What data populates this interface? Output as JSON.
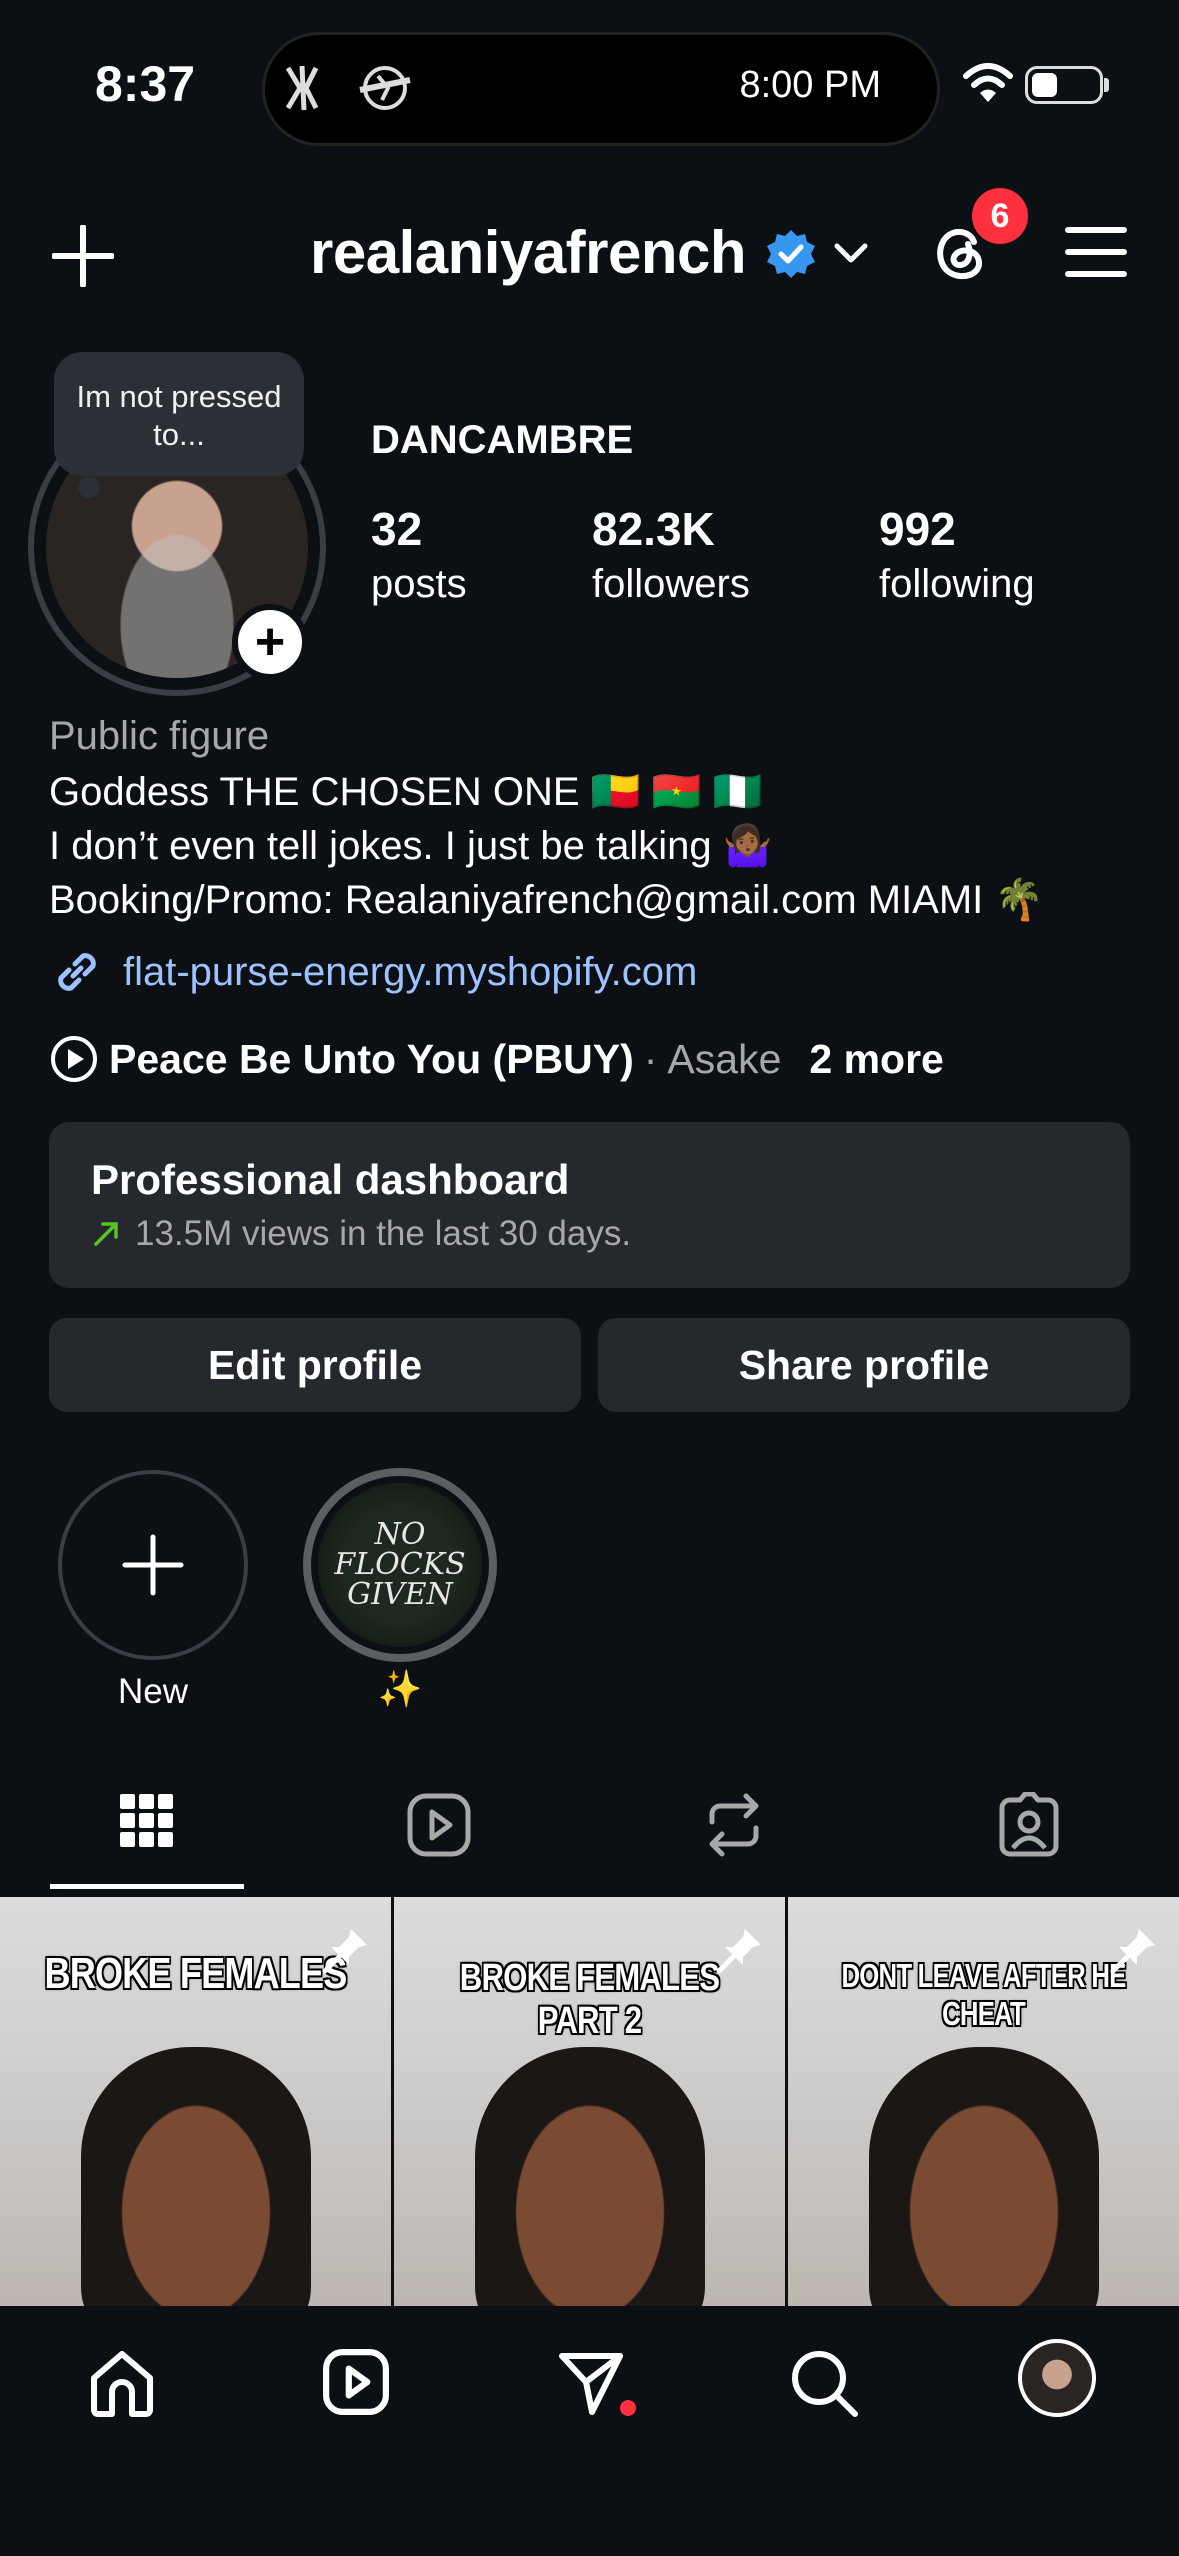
{
  "status_bar": {
    "time": "8:37",
    "island_time": "8:00 PM",
    "battery_level": 0.35
  },
  "header": {
    "username": "realaniyafrench",
    "notification_count": "6",
    "icons": [
      "plus-icon",
      "verified-badge-icon",
      "chevron-down-icon",
      "threads-icon",
      "menu-icon"
    ]
  },
  "profile": {
    "note": "Im not pressed to...",
    "display_name": "DANCAMBRE",
    "stats": [
      {
        "value": "32",
        "label": "posts"
      },
      {
        "value": "82.3K",
        "label": "followers"
      },
      {
        "value": "992",
        "label": "following"
      }
    ],
    "category": "Public figure",
    "bio_lines": [
      "Goddess THE CHOSEN ONE 🇧🇯 🇧🇫 🇳🇬",
      "I don’t even tell jokes. I just be talking 🤷🏾‍♀️",
      "Booking/Promo: Realaniyafrench@gmail.com MIAMI 🌴"
    ],
    "link": "flat-purse-energy.myshopify.com",
    "music": {
      "song": "Peace Be Unto You (PBUY)",
      "separator": "·",
      "artist": "Asake",
      "more": "2 more"
    }
  },
  "dashboard": {
    "title": "Professional dashboard",
    "subtitle": "13.5M views in the last 30 days."
  },
  "buttons": {
    "edit": "Edit profile",
    "share": "Share profile"
  },
  "highlights": [
    {
      "label": "New"
    },
    {
      "label": "✨",
      "cover_text": "NO FLOCKS GIVEN"
    }
  ],
  "tabs": [
    "grid-icon",
    "reels-icon",
    "reposts-icon",
    "tagged-icon"
  ],
  "posts": [
    {
      "caption": "BROKE FEMALES",
      "pinned": true
    },
    {
      "caption": "BROKE FEMALES PART 2",
      "pinned": true
    },
    {
      "caption": "DONT LEAVE AFTER HE CHEAT",
      "pinned": true
    }
  ],
  "bottom_nav": [
    "home-icon",
    "reels-icon",
    "direct-message-icon",
    "search-icon",
    "profile-avatar"
  ]
}
